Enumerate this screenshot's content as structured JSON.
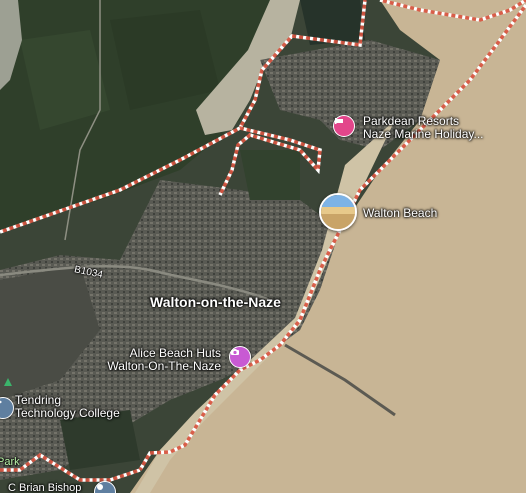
{
  "map": {
    "type": "satellite",
    "colors": {
      "sea": "#c8b595",
      "land_dark": "#3a4436",
      "urban": "#5b5c55",
      "boundary": "#e07060",
      "pin_lodging": "#e3468b",
      "pin_attraction": "#ce5ad9"
    }
  },
  "places": {
    "town": "Walton-on-the-Naze",
    "road_b1034": "B1034"
  },
  "pois": [
    {
      "name_line1": "Parkdean Resorts",
      "name_line2": "Naze Marine Holiday...",
      "icon": "bed-icon"
    },
    {
      "name_line1": "Walton Beach",
      "icon": "beach-photo"
    },
    {
      "name_line1": "Alice Beach Huts",
      "name_line2": "Walton-On-The-Naze",
      "icon": "camera-icon"
    },
    {
      "name_line1": "Tendring",
      "name_line2": "Technology College",
      "icon": "school-icon"
    },
    {
      "name_line1": "C Brian Bishop",
      "icon": "place-icon"
    },
    {
      "name_line1": "Park",
      "icon": "park-icon"
    }
  ]
}
